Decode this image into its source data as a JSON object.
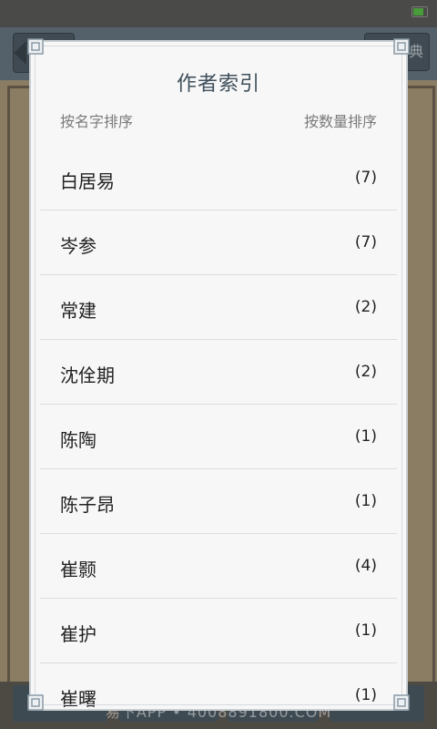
{
  "background": {
    "right_button_label": "典",
    "watermark": "易下APP • 4008891800.COM"
  },
  "dialog": {
    "title": "作者索引",
    "sort_by_name": "按名字排序",
    "sort_by_count": "按数量排序",
    "authors": [
      {
        "name": "白居易",
        "count": "(7)"
      },
      {
        "name": "岑参",
        "count": "(7)"
      },
      {
        "name": "常建",
        "count": "(2)"
      },
      {
        "name": "沈佺期",
        "count": "(2)"
      },
      {
        "name": "陈陶",
        "count": "(1)"
      },
      {
        "name": "陈子昂",
        "count": "(1)"
      },
      {
        "name": "崔颢",
        "count": "(4)"
      },
      {
        "name": "崔护",
        "count": "(1)"
      },
      {
        "name": "崔曙",
        "count": "(1)"
      }
    ]
  },
  "colors": {
    "title": "#3e4f5b",
    "dialog_bg": "#f7f7f7",
    "divider": "#dcdcdc"
  }
}
